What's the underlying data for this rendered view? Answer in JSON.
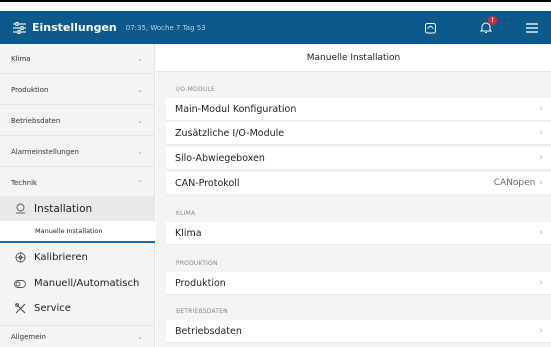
{
  "header": {
    "title": "Einstellungen",
    "time": "07:35, Woche 7 Tag 53",
    "alarm_badge": "!"
  },
  "sidebar": {
    "categories": [
      {
        "label": "Klima"
      },
      {
        "label": "Produktion"
      },
      {
        "label": "Betriebsdaten"
      },
      {
        "label": "Alarmeinstellungen"
      },
      {
        "label": "Technik"
      }
    ],
    "items": [
      {
        "label": "Installation"
      },
      {
        "label": "Kalibrieren"
      },
      {
        "label": "Manuell/Automatisch"
      },
      {
        "label": "Service"
      }
    ],
    "sub_item": "Manuelle Installation",
    "bottom_category": "Allgemein"
  },
  "main": {
    "title": "Manuelle Installation",
    "sections": [
      {
        "label": "I/O-MODULE",
        "rows": [
          {
            "label": "Main-Modul Konfiguration",
            "value": ""
          },
          {
            "label": "Zusätzliche I/O-Module",
            "value": ""
          },
          {
            "label": "Silo-Abwiegeboxen",
            "value": ""
          },
          {
            "label": "CAN-Protokoll",
            "value": "CANopen"
          }
        ]
      },
      {
        "label": "KLIMA",
        "rows": [
          {
            "label": "Klima",
            "value": ""
          }
        ]
      },
      {
        "label": "PRODUKTION",
        "rows": [
          {
            "label": "Produktion",
            "value": ""
          }
        ]
      },
      {
        "label": "BETRIEBSDATEN",
        "rows": [
          {
            "label": "Betriebsdaten",
            "value": ""
          }
        ]
      }
    ]
  }
}
